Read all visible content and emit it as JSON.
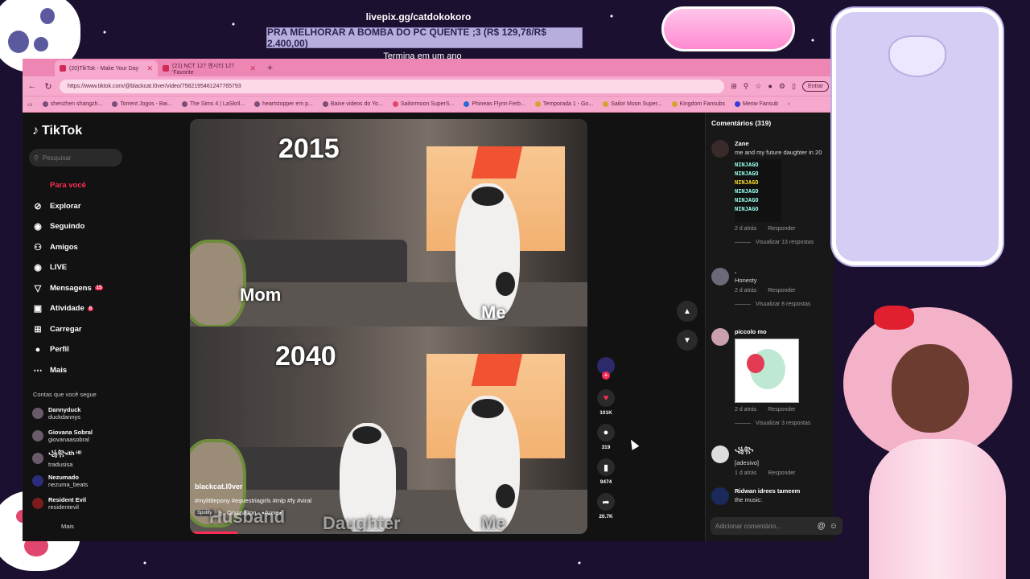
{
  "overlay": {
    "pix_url": "livepix.gg/catdokokoro",
    "pix_banner": "PRA MELHORAR A BOMBA DO PC QUENTE ;3 (R$ 129,78/R$ 2.400,00)",
    "pix_sub": "Termina em um ano",
    "logo_text": "catdokokoro"
  },
  "browser": {
    "tabs": [
      {
        "label": "(20)TikTok - Make Your Day"
      },
      {
        "label": "(21) NCT 127 엔시티 127 'Favorite"
      }
    ],
    "new_tab": "+",
    "url": "https://www.tiktok.com/@blackcat.l0ver/video/7582195461247765793",
    "entrar": "Entrar",
    "bookmarks": [
      "shenzhen shangzh...",
      "Torrent Jogos - Bai...",
      "The Sims 4 | LaSkril...",
      "heartstopper em p...",
      "Baixe videos do Yo...",
      "Sailormoon SuperS...",
      "Phineas Flynn Ferb...",
      "Temporada 1 - Go...",
      "Sailor Moon Super...",
      "Kingdom Fansubs",
      "Meow Fansub"
    ]
  },
  "sidebar": {
    "logo": "TikTok",
    "search_placeholder": "Pesquisar",
    "menu": [
      {
        "label": "Para você",
        "icon": "home"
      },
      {
        "label": "Explorar",
        "icon": "compass"
      },
      {
        "label": "Seguindo",
        "icon": "following"
      },
      {
        "label": "Amigos",
        "icon": "friends"
      },
      {
        "label": "LIVE",
        "icon": "live"
      },
      {
        "label": "Mensagens",
        "icon": "messages"
      },
      {
        "label": "Atividade",
        "icon": "activity"
      },
      {
        "label": "Carregar",
        "icon": "upload"
      },
      {
        "label": "Perfil",
        "icon": "profile"
      },
      {
        "label": "Mais",
        "icon": "more"
      }
    ],
    "messages_badge": "15",
    "activity_badge": "8",
    "following_title": "Contas que você segue",
    "following": [
      {
        "name": "Dannyduck",
        "handle": "duckdannys"
      },
      {
        "name": "Giovana Sobral",
        "handle": "giovanaasobral"
      },
      {
        "name": "꧁꧂ith ᴴᴰ",
        "handle": "tradusisa"
      },
      {
        "name": "Nezumado",
        "handle": "nezuma_beats"
      },
      {
        "name": "Resident Evil",
        "handle": "residentevil"
      }
    ],
    "more_label": "Mais"
  },
  "video": {
    "year_top": "2015",
    "year_bottom": "2040",
    "label_mom": "Mom",
    "label_me_top": "Me",
    "label_husband": "Husband",
    "label_daughter": "Daughter",
    "label_me_bottom": "Me",
    "author": "blackcat.l0ver",
    "hashtags": "#mylittlepony #equestriagirls #mlp #fy #viral",
    "spotify": "Spotify",
    "music": "Originalton - ⭑Anne⭑",
    "progress": 0.12
  },
  "actions": {
    "likes": "101K",
    "comments": "319",
    "saves": "9474",
    "shares": "20.7K"
  },
  "comments": {
    "title": "Comentários (319)",
    "items": [
      {
        "name": "Zane",
        "text": "me and my future daughter in 20",
        "time": "2 d atrás",
        "reply": "Responder",
        "replies": "Visualizar 13 respostas"
      },
      {
        "name": ".",
        "text": "Honesty",
        "time": "2 d atrás",
        "reply": "Responder",
        "replies": "Visualizar 8 respostas"
      },
      {
        "name": "piccolo mo",
        "text": "",
        "time": "2 d atrás",
        "reply": "Responder",
        "replies": "Visualizar 3 respostas"
      },
      {
        "name": "꧁꧂",
        "text": "[adesivo]",
        "time": "1 d atrás",
        "reply": "Responder",
        "replies": ""
      },
      {
        "name": "Ridwan idrees tameem",
        "text": "the music:",
        "time": "",
        "reply": "",
        "replies": ""
      }
    ],
    "ninjago_text": "NINJAGO",
    "input_placeholder": "Adicionar comentário..."
  }
}
